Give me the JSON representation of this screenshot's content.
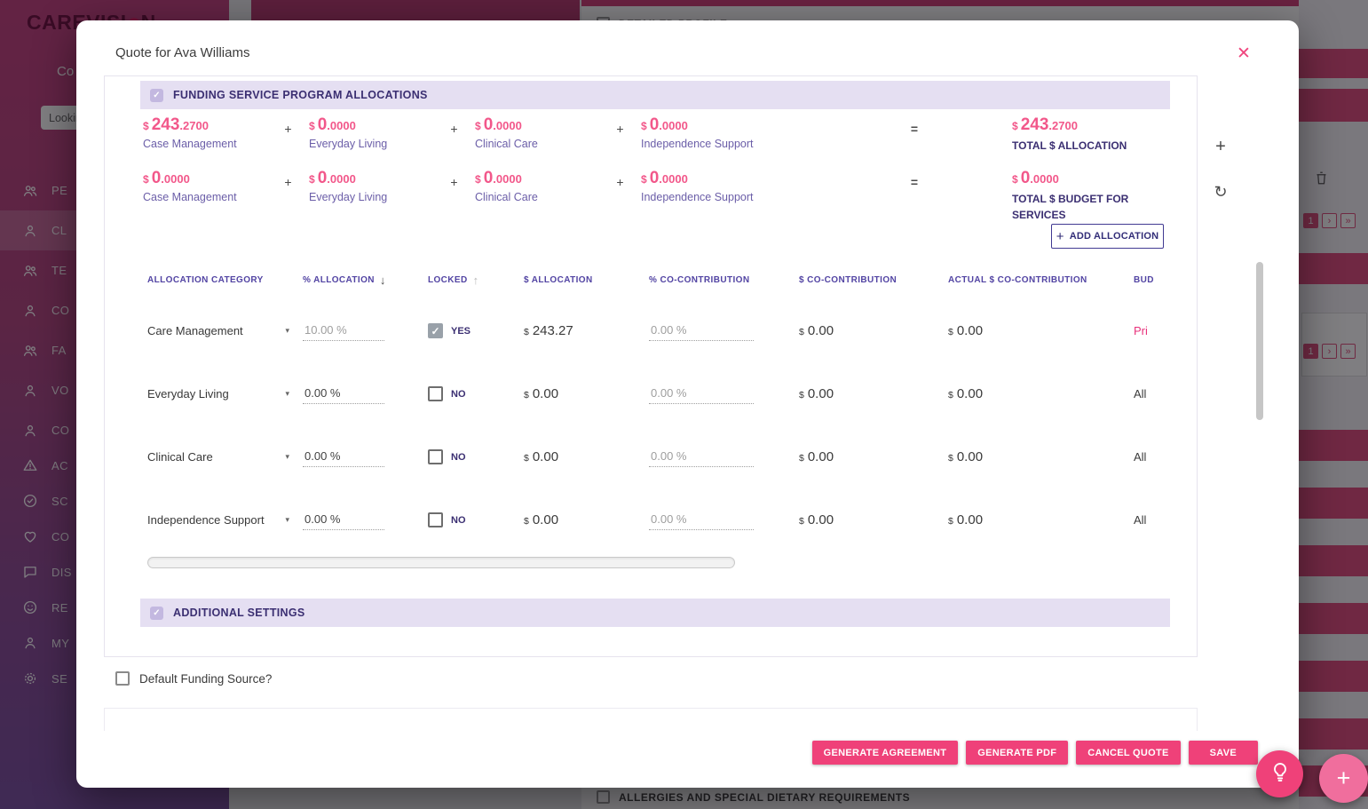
{
  "currency": "$",
  "icons": {
    "close": "✕",
    "plus": "+",
    "refresh": "↻",
    "check": "✓",
    "caret": "▾",
    "sort_desc": "↓",
    "sort_asc": "↑",
    "next": "›",
    "last": "»",
    "fab_plus": "+"
  },
  "background": {
    "brand_left": "CAREVISI",
    "brand_right": "N",
    "nav_partial": "Co",
    "search_partial": "Looking",
    "top_panel_title": "DETAILED PROFILE",
    "bottom_panel_title": "ALLERGIES AND SPECIAL DIETARY REQUIREMENTS",
    "page_number": "1",
    "sidebar_primary": [
      {
        "label": "PE"
      },
      {
        "label": "CL"
      },
      {
        "label": "TE"
      },
      {
        "label": "CO"
      },
      {
        "label": "FA"
      },
      {
        "label": "VO"
      },
      {
        "label": "CO"
      }
    ],
    "sidebar_secondary": [
      {
        "label": "AC"
      },
      {
        "label": "SC"
      },
      {
        "label": "CO"
      },
      {
        "label": "DIS"
      },
      {
        "label": "RE"
      },
      {
        "label": "MY"
      },
      {
        "label": "SE"
      }
    ]
  },
  "modal": {
    "title": "Quote for Ava Williams",
    "funding": {
      "title": "FUNDING SERVICE PROGRAM ALLOCATIONS",
      "op_plus": "+",
      "op_equals": "=",
      "row1": {
        "items": [
          {
            "whole": "243",
            "frac": ".2700",
            "label": "Case Management"
          },
          {
            "whole": "0",
            "frac": ".0000",
            "label": "Everyday Living"
          },
          {
            "whole": "0",
            "frac": ".0000",
            "label": "Clinical Care"
          },
          {
            "whole": "0",
            "frac": ".0000",
            "label": "Independence Support"
          }
        ],
        "total": {
          "whole": "243",
          "frac": ".2700",
          "label": "TOTAL $ ALLOCATION"
        }
      },
      "row2": {
        "items": [
          {
            "whole": "0",
            "frac": ".0000",
            "label": "Case Management"
          },
          {
            "whole": "0",
            "frac": ".0000",
            "label": "Everyday Living"
          },
          {
            "whole": "0",
            "frac": ".0000",
            "label": "Clinical Care"
          },
          {
            "whole": "0",
            "frac": ".0000",
            "label": "Independence Support"
          }
        ],
        "total": {
          "whole": "0",
          "frac": ".0000",
          "label": "TOTAL $ BUDGET FOR SERVICES"
        }
      },
      "add_allocation_label": "ADD ALLOCATION",
      "table": {
        "headers": {
          "category": "ALLOCATION CATEGORY",
          "pct_allocation": "% ALLOCATION",
          "locked": "LOCKED",
          "allocation": "$ ALLOCATION",
          "pct_co": "% CO-CONTRIBUTION",
          "co": "$ CO-CONTRIBUTION",
          "actual_co": "ACTUAL $ CO-CONTRIBUTION",
          "budget": "BUD"
        },
        "rows": [
          {
            "category": "Care Management",
            "pct": "10.00 %",
            "locked_label": "YES",
            "allocation": "243.27",
            "pct_co": "0.00 %",
            "co": "0.00",
            "actual_co": "0.00",
            "budget": "Pri"
          },
          {
            "category": "Everyday Living",
            "pct": "0.00 %",
            "locked_label": "NO",
            "allocation": "0.00",
            "pct_co": "0.00 %",
            "co": "0.00",
            "actual_co": "0.00",
            "budget": "All"
          },
          {
            "category": "Clinical Care",
            "pct": "0.00 %",
            "locked_label": "NO",
            "allocation": "0.00",
            "pct_co": "0.00 %",
            "co": "0.00",
            "actual_co": "0.00",
            "budget": "All"
          },
          {
            "category": "Independence Support",
            "pct": "0.00 %",
            "locked_label": "NO",
            "allocation": "0.00",
            "pct_co": "0.00 %",
            "co": "0.00",
            "actual_co": "0.00",
            "budget": "All"
          }
        ]
      }
    },
    "additional_title": "ADDITIONAL SETTINGS",
    "default_funding_label": "Default Funding Source?",
    "footer_buttons": [
      {
        "label": "GENERATE AGREEMENT"
      },
      {
        "label": "GENERATE PDF"
      },
      {
        "label": "CANCEL QUOTE"
      },
      {
        "label": "SAVE"
      }
    ]
  }
}
